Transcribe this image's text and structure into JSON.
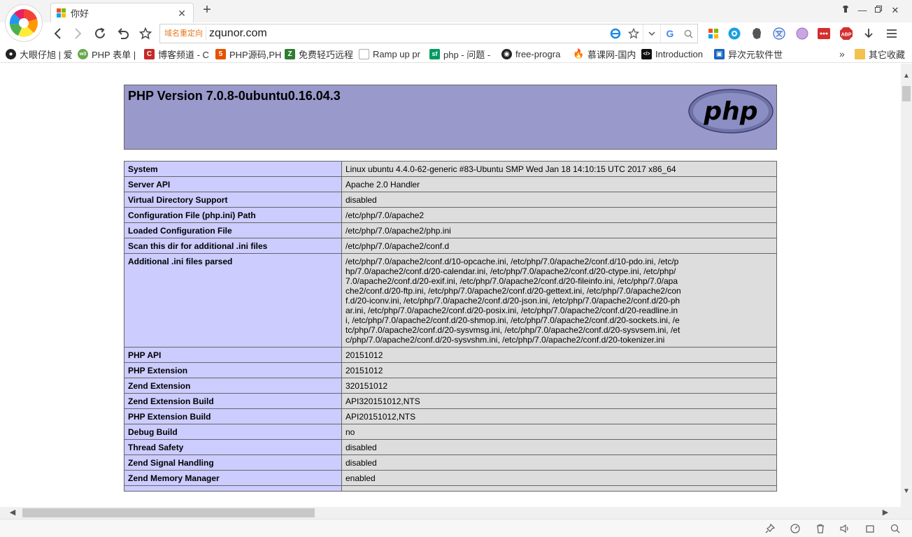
{
  "browser": {
    "tab": {
      "title": "你好"
    },
    "address": {
      "redirect_label": "域名重定向",
      "url": "zqunor.com"
    },
    "bookmarks": [
      {
        "label": "大眼仔旭 | 爱"
      },
      {
        "label": "PHP 表单 |"
      },
      {
        "label": "博客频道 - C"
      },
      {
        "label": "PHP源码,PH"
      },
      {
        "label": "免费轻巧远程"
      },
      {
        "label": "Ramp up pr"
      },
      {
        "label": "php - 问题 -"
      },
      {
        "label": "free-progra"
      },
      {
        "label": "慕课网-国内"
      },
      {
        "label": "Introduction"
      },
      {
        "label": "异次元软件世"
      }
    ],
    "other_bookmarks": "其它收藏",
    "more_bookmarks": "»",
    "colors": {
      "php_header": "#9999cc",
      "key_cell": "#ccccff",
      "value_cell": "#dddddd"
    }
  },
  "page": {
    "title": "PHP Version 7.0.8-0ubuntu0.16.04.3",
    "logo_text": "php",
    "rows": [
      {
        "key": "System",
        "value": "Linux ubuntu 4.4.0-62-generic #83-Ubuntu SMP Wed Jan 18 14:10:15 UTC 2017 x86_64"
      },
      {
        "key": "Server API",
        "value": "Apache 2.0 Handler"
      },
      {
        "key": "Virtual Directory Support",
        "value": "disabled"
      },
      {
        "key": "Configuration File (php.ini) Path",
        "value": "/etc/php/7.0/apache2"
      },
      {
        "key": "Loaded Configuration File",
        "value": "/etc/php/7.0/apache2/php.ini"
      },
      {
        "key": "Scan this dir for additional .ini files",
        "value": "/etc/php/7.0/apache2/conf.d"
      },
      {
        "key": "Additional .ini files parsed",
        "value": "/etc/php/7.0/apache2/conf.d/10-opcache.ini, /etc/php/7.0/apache2/conf.d/10-pdo.ini, /etc/php/7.0/apache2/conf.d/20-calendar.ini, /etc/php/7.0/apache2/conf.d/20-ctype.ini, /etc/php/7.0/apache2/conf.d/20-exif.ini, /etc/php/7.0/apache2/conf.d/20-fileinfo.ini, /etc/php/7.0/apache2/conf.d/20-ftp.ini, /etc/php/7.0/apache2/conf.d/20-gettext.ini, /etc/php/7.0/apache2/conf.d/20-iconv.ini, /etc/php/7.0/apache2/conf.d/20-json.ini, /etc/php/7.0/apache2/conf.d/20-phar.ini, /etc/php/7.0/apache2/conf.d/20-posix.ini, /etc/php/7.0/apache2/conf.d/20-readline.ini, /etc/php/7.0/apache2/conf.d/20-shmop.ini, /etc/php/7.0/apache2/conf.d/20-sockets.ini, /etc/php/7.0/apache2/conf.d/20-sysvmsg.ini, /etc/php/7.0/apache2/conf.d/20-sysvsem.ini, /etc/php/7.0/apache2/conf.d/20-sysvshm.ini, /etc/php/7.0/apache2/conf.d/20-tokenizer.ini"
      },
      {
        "key": "PHP API",
        "value": "20151012"
      },
      {
        "key": "PHP Extension",
        "value": "20151012"
      },
      {
        "key": "Zend Extension",
        "value": "320151012"
      },
      {
        "key": "Zend Extension Build",
        "value": "API320151012,NTS"
      },
      {
        "key": "PHP Extension Build",
        "value": "API20151012,NTS"
      },
      {
        "key": "Debug Build",
        "value": "no"
      },
      {
        "key": "Thread Safety",
        "value": "disabled"
      },
      {
        "key": "Zend Signal Handling",
        "value": "disabled"
      },
      {
        "key": "Zend Memory Manager",
        "value": "enabled"
      },
      {
        "key": "",
        "value": ""
      }
    ]
  }
}
